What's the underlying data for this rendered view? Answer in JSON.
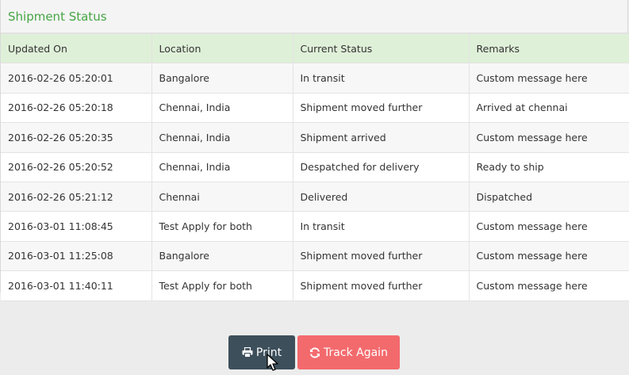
{
  "panel": {
    "title": "Shipment Status"
  },
  "table": {
    "headers": [
      "Updated On",
      "Location",
      "Current Status",
      "Remarks"
    ],
    "rows": [
      [
        "2016-02-26 05:20:01",
        "Bangalore",
        "In transit",
        "Custom message here"
      ],
      [
        "2016-02-26 05:20:18",
        "Chennai, India",
        "Shipment moved further",
        "Arrived at chennai"
      ],
      [
        "2016-02-26 05:20:35",
        "Chennai, India",
        "Shipment arrived",
        "Custom message here"
      ],
      [
        "2016-02-26 05:20:52",
        "Chennai, India",
        "Despatched for delivery",
        "Ready to ship"
      ],
      [
        "2016-02-26 05:21:12",
        "Chennai",
        "Delivered",
        "Dispatched"
      ],
      [
        "2016-03-01 11:08:45",
        "Test Apply for both",
        "In transit",
        "Custom message here"
      ],
      [
        "2016-03-01 11:25:08",
        "Bangalore",
        "Shipment moved further",
        "Custom message here"
      ],
      [
        "2016-03-01 11:40:11",
        "Test Apply for both",
        "Shipment moved further",
        "Custom message here"
      ]
    ]
  },
  "buttons": {
    "print": {
      "label": "Print",
      "icon": "print-icon",
      "color": "#3d4f5b"
    },
    "track_again": {
      "label": "Track Again",
      "icon": "refresh-icon",
      "color": "#f36a6d"
    }
  },
  "colors": {
    "title": "#46a546",
    "header_row": "#dff0d8"
  }
}
